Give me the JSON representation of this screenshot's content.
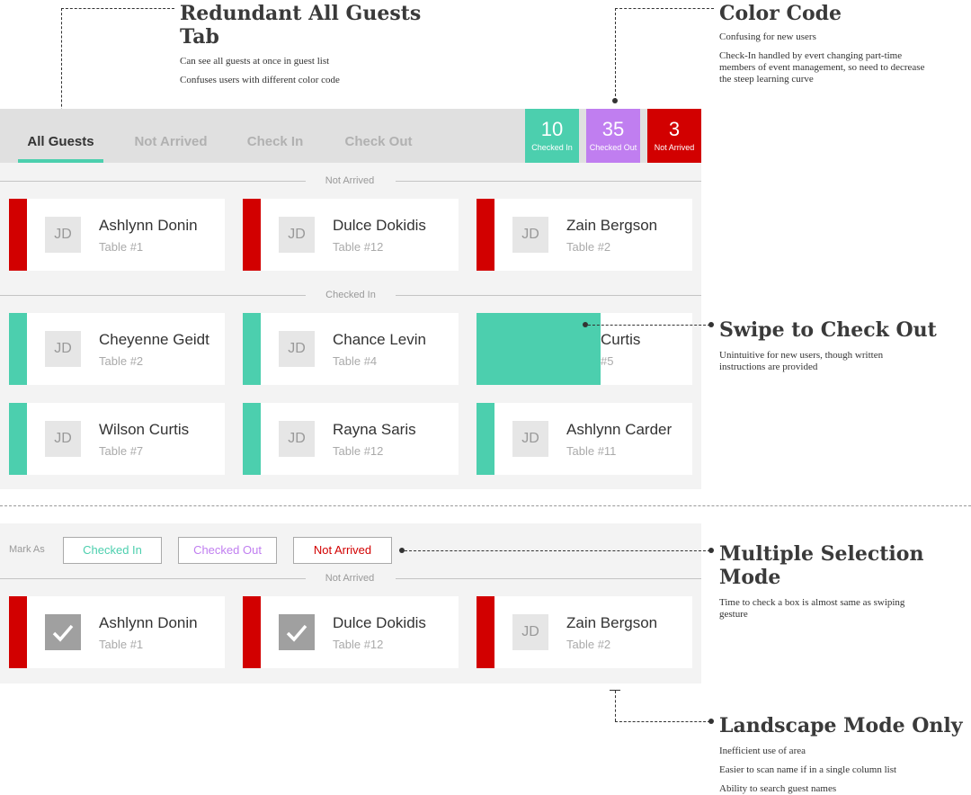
{
  "annotations": {
    "redundant_tab": {
      "title_line1": "Redundant All Guests",
      "title_line2": "Tab",
      "lines": [
        "Can see all guests at once in guest list",
        "Confuses users with different color code"
      ]
    },
    "color_code": {
      "title": "Color Code",
      "lines": [
        "Confusing for new users",
        "Check-In handled by evert changing part-time",
        "members of event management, so need to decrease",
        "the steep learning curve"
      ]
    },
    "swipe": {
      "title": "Swipe to Check Out",
      "lines": [
        "Unintuitive for new users, though written",
        "instructions are provided"
      ]
    },
    "multi_select": {
      "title_line1": "Multiple Selection",
      "title_line2": "Mode",
      "lines": [
        "Time to check a box is almost same as swiping",
        "gesture"
      ]
    },
    "landscape": {
      "title": "Landscape Mode Only",
      "lines": [
        "Inefficient use of area",
        "Easier to scan name if in a single column list",
        "Ability to search guest names"
      ]
    }
  },
  "tabs": [
    {
      "label": "All Guests",
      "active": true
    },
    {
      "label": "Not Arrived",
      "active": false
    },
    {
      "label": "Check In",
      "active": false
    },
    {
      "label": "Check Out",
      "active": false
    }
  ],
  "stats": [
    {
      "value": "10",
      "label": "Checked In",
      "color": "#4ccfae"
    },
    {
      "value": "35",
      "label": "Checked Out",
      "color": "#c07ef0"
    },
    {
      "value": "3",
      "label": "Not Arrived",
      "color": "#d20000"
    }
  ],
  "sections": {
    "not_arrived": "Not Arrived",
    "checked_in": "Checked In"
  },
  "avatar_initials": "JD",
  "not_arrived_guests": [
    {
      "name": "Ashlynn Donin",
      "table": "Table #1"
    },
    {
      "name": "Dulce Dokidis",
      "table": "Table #12"
    },
    {
      "name": "Zain Bergson",
      "table": "Table #2"
    }
  ],
  "checked_in_guests": [
    {
      "name": "Cheyenne Geidt",
      "table": "Table #2"
    },
    {
      "name": "Chance Levin",
      "table": "Table #4"
    },
    {
      "name": "Curtis",
      "table": "#5"
    },
    {
      "name": "Wilson Curtis",
      "table": "Table #7"
    },
    {
      "name": "Rayna Saris",
      "table": "Table #12"
    },
    {
      "name": "Ashlynn Carder",
      "table": "Table #11"
    }
  ],
  "selection_mode": {
    "mark_as_label": "Mark As",
    "buttons": [
      {
        "label": "Checked In",
        "color": "#4ccfae"
      },
      {
        "label": "Checked Out",
        "color": "#c07ef0"
      },
      {
        "label": "Not Arrived",
        "color": "#d20000"
      }
    ],
    "section_label": "Not Arrived",
    "guests": [
      {
        "name": "Ashlynn Donin",
        "table": "Table #1",
        "selected": true
      },
      {
        "name": "Dulce Dokidis",
        "table": "Table #12",
        "selected": true
      },
      {
        "name": "Zain Bergson",
        "table": "Table #2",
        "selected": false
      }
    ]
  }
}
